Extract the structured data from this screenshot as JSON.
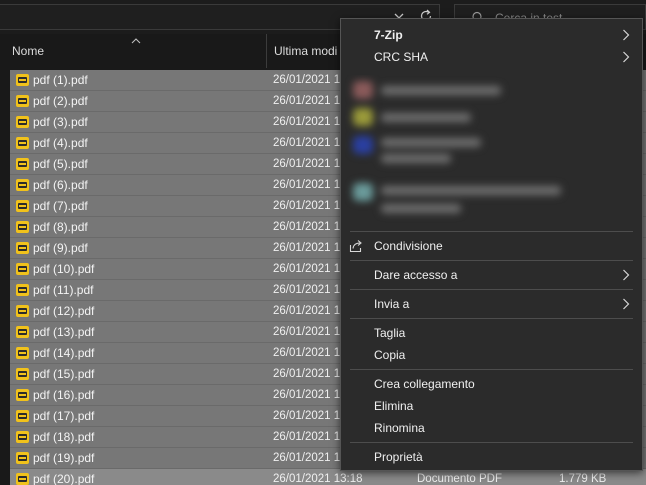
{
  "search": {
    "placeholder": "Cerca in test"
  },
  "columns": {
    "name": "Nome",
    "date": "Ultima modi"
  },
  "files": [
    {
      "name": "pdf (1).pdf",
      "date": "26/01/2021 1"
    },
    {
      "name": "pdf (2).pdf",
      "date": "26/01/2021 1"
    },
    {
      "name": "pdf (3).pdf",
      "date": "26/01/2021 1"
    },
    {
      "name": "pdf (4).pdf",
      "date": "26/01/2021 1"
    },
    {
      "name": "pdf (5).pdf",
      "date": "26/01/2021 1"
    },
    {
      "name": "pdf (6).pdf",
      "date": "26/01/2021 1"
    },
    {
      "name": "pdf (7).pdf",
      "date": "26/01/2021 1"
    },
    {
      "name": "pdf (8).pdf",
      "date": "26/01/2021 1"
    },
    {
      "name": "pdf (9).pdf",
      "date": "26/01/2021 1"
    },
    {
      "name": "pdf (10).pdf",
      "date": "26/01/2021 1"
    },
    {
      "name": "pdf (11).pdf",
      "date": "26/01/2021 1"
    },
    {
      "name": "pdf (12).pdf",
      "date": "26/01/2021 1"
    },
    {
      "name": "pdf (13).pdf",
      "date": "26/01/2021 1"
    },
    {
      "name": "pdf (14).pdf",
      "date": "26/01/2021 1"
    },
    {
      "name": "pdf (15).pdf",
      "date": "26/01/2021 1"
    },
    {
      "name": "pdf (16).pdf",
      "date": "26/01/2021 1"
    },
    {
      "name": "pdf (17).pdf",
      "date": "26/01/2021 1"
    },
    {
      "name": "pdf (18).pdf",
      "date": "26/01/2021 1"
    },
    {
      "name": "pdf (19).pdf",
      "date": "26/01/2021 1"
    },
    {
      "name": "pdf (20).pdf",
      "date": "26/01/2021 13:18",
      "type": "Documento PDF",
      "size": "1.779 KB"
    }
  ],
  "context_menu": {
    "zip": "7-Zip",
    "crc": "CRC SHA",
    "share": "Condivisione",
    "give_access": "Dare accesso a",
    "send_to": "Invia a",
    "cut": "Taglia",
    "copy": "Copia",
    "create_shortcut": "Crea collegamento",
    "delete": "Elimina",
    "rename": "Rinomina",
    "properties": "Proprietà"
  },
  "colors": {
    "background": "#191919",
    "selected_row": "#777777",
    "menu_background": "#2b2b2b",
    "pdf_icon": "#f1c21b"
  },
  "icons": [
    "chevron-down-icon",
    "refresh-icon",
    "search-icon",
    "sort-up-icon",
    "pdf-file-icon",
    "share-icon",
    "chevron-right-icon"
  ]
}
